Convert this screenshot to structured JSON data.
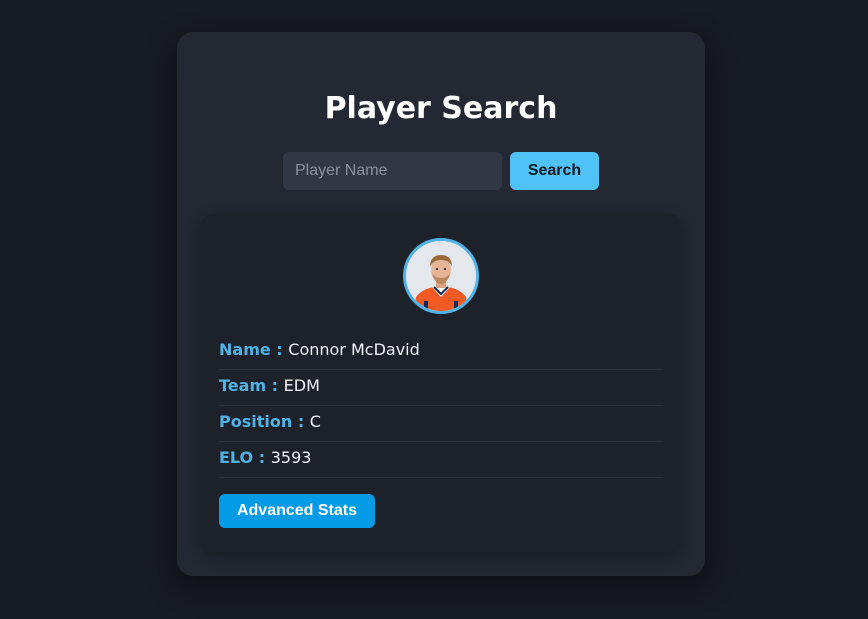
{
  "header": {
    "title": "Player Search"
  },
  "search": {
    "placeholder": "Player Name",
    "value": "",
    "button_label": "Search"
  },
  "player": {
    "avatar_alt": "Connor McDavid",
    "fields": [
      {
        "label": "Name",
        "separator": " : ",
        "value": "Connor McDavid"
      },
      {
        "label": "Team",
        "separator": " : ",
        "value": "EDM"
      },
      {
        "label": "Position",
        "separator": " : ",
        "value": "C"
      },
      {
        "label": "ELO",
        "separator": " : ",
        "value": "3593"
      }
    ],
    "advanced_button_label": "Advanced Stats"
  },
  "colors": {
    "page_bg": "#171b22",
    "panel_bg": "#232833",
    "card_bg": "#1c212a",
    "accent": "#4fb3e8",
    "search_button": "#4fc3f7",
    "advanced_button": "#039be5",
    "jersey": "#f15a24"
  }
}
